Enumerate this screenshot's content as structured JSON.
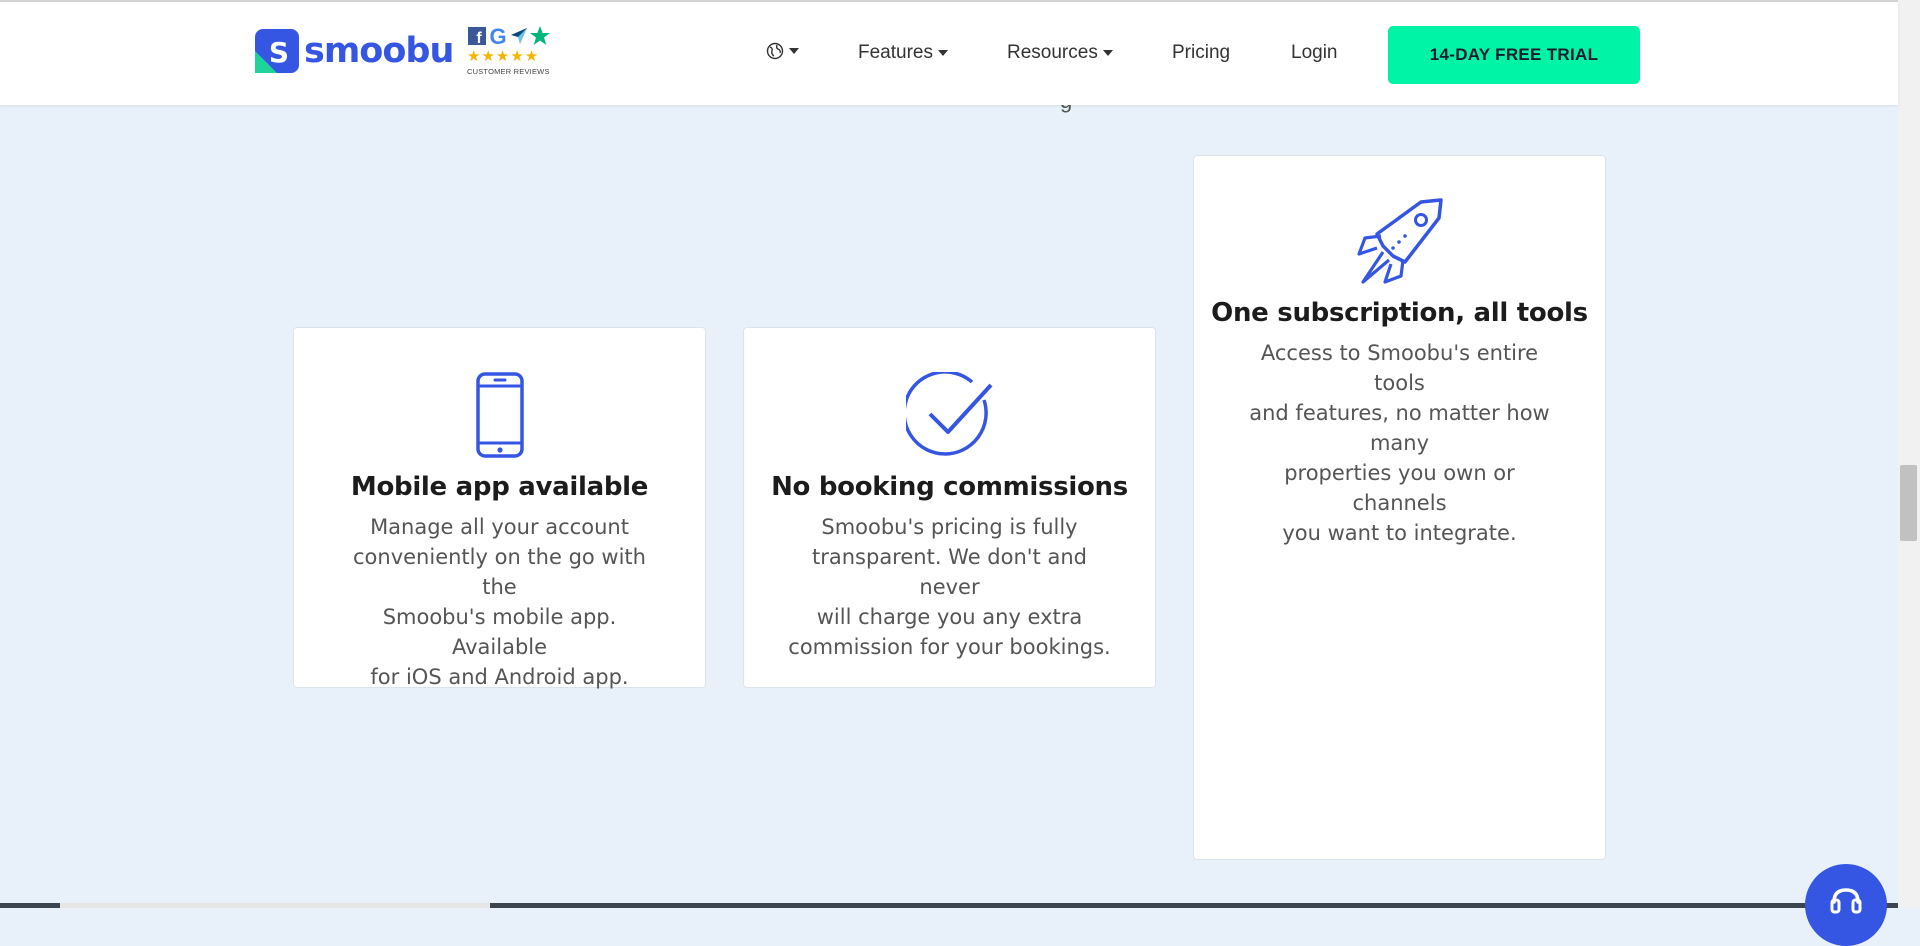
{
  "brand": {
    "name": "smoobu",
    "logo_letter": "S",
    "color": "#3556e3",
    "accent": "#1fd49a"
  },
  "reviews_badge": {
    "caption": "CUSTOMER REVIEWS",
    "stars": "★★★★★",
    "rating_stars": 5,
    "icons": [
      "facebook-icon",
      "google-icon",
      "capterra-icon",
      "trustpilot-icon"
    ]
  },
  "nav": {
    "language_icon": "globe-icon",
    "items": [
      {
        "label": "Features",
        "has_dropdown": true
      },
      {
        "label": "Resources",
        "has_dropdown": true
      },
      {
        "label": "Pricing",
        "has_dropdown": false
      },
      {
        "label": "Login",
        "has_dropdown": false
      }
    ],
    "cta_label": "14-DAY FREE TRIAL",
    "cta_color": "#00f4a6"
  },
  "section": {
    "background": "#e8f1fa",
    "heading_fragment": "g"
  },
  "cards": [
    {
      "icon": "smartphone-icon",
      "title": "Mobile app available",
      "desc_lines": [
        "Manage all your account",
        "conveniently on the go with the",
        "Smoobu's mobile app. Available",
        "for iOS and Android app."
      ]
    },
    {
      "icon": "checkmark-circle-icon",
      "title": "No booking commissions",
      "desc_lines": [
        "Smoobu's pricing is fully",
        "transparent. We don't and never",
        "will charge you any extra",
        "commission for your bookings."
      ]
    },
    {
      "icon": "rocket-icon",
      "title": "One subscription, all tools",
      "desc_lines": [
        "Access to Smoobu's entire tools",
        "and features, no matter how many",
        "properties you own or channels",
        "you want to integrate."
      ]
    }
  ],
  "chat_widget": {
    "icon": "chat-icon"
  }
}
